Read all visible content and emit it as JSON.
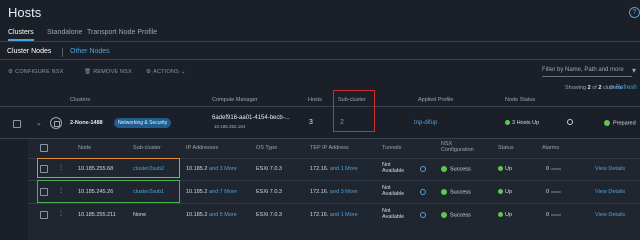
{
  "page": {
    "title": "Hosts",
    "help": "?"
  },
  "main_tabs": [
    "Clusters",
    "Standalone",
    "Transport Node Profile"
  ],
  "sub_tabs": [
    "Cluster Nodes",
    "Other Nodes"
  ],
  "actions": {
    "configure": "CONFIGURE NSX",
    "remove": "REMOVE NSX",
    "actions": "ACTIONS"
  },
  "filter": {
    "placeholder": "Filter by Name, Path and more"
  },
  "paging": {
    "prefix": "Showing",
    "current": "2",
    "of": "of",
    "total": "2",
    "suffix": "clusters",
    "refresh": "Refresh"
  },
  "outer_headers": [
    "Clusters",
    "Compute Manager",
    "Hosts",
    "Sub-cluster",
    "Applied Profile",
    "Node Status"
  ],
  "cluster": {
    "name": "2-None-1488",
    "badge": "Networking & Security",
    "compute_manager": "6adef916-aa01-4154-becb-...",
    "compute_manager_ip": "10.185.252.164",
    "hosts": "3",
    "subcluster": "2",
    "profile": "tnp-difup",
    "node_status": "3 Hosts Up",
    "state": "Prepared"
  },
  "inner_headers": [
    "Node",
    "Sub-cluster",
    "IP Addresses",
    "OS Type",
    "TEP IP Address",
    "Tunnels",
    "NSX Configuration",
    "Status",
    "Alarms"
  ],
  "nodes": [
    {
      "node": "10.185.255.68",
      "subcluster": "cluster2sub2",
      "ip": "10.185.2",
      "ip_more": "and 3 More",
      "os": "ESXi 7.0.3",
      "tep": "172.16.",
      "tep_more": "and 1 More",
      "tunnels": "Not Available",
      "nsx": "Success",
      "status": "Up",
      "alarms": "0",
      "view": "View Details"
    },
    {
      "node": "10.185.245.26",
      "subcluster": "cluster2sub1",
      "ip": "10.185.2",
      "ip_more": "and 7 More",
      "os": "ESXi 7.0.3",
      "tep": "172.16.",
      "tep_more": "and 3 More",
      "tunnels": "Not Available",
      "nsx": "Success",
      "status": "Up",
      "alarms": "0",
      "view": "View Details"
    },
    {
      "node": "10.185.255.211",
      "subcluster": "None",
      "ip": "10.185.2",
      "ip_more": "and 5 More",
      "os": "ESXi 7.0.3",
      "tep": "172.16.",
      "tep_more": "and 1 More",
      "tunnels": "Not Available",
      "nsx": "Success",
      "status": "Up",
      "alarms": "0",
      "view": "View Details"
    }
  ]
}
